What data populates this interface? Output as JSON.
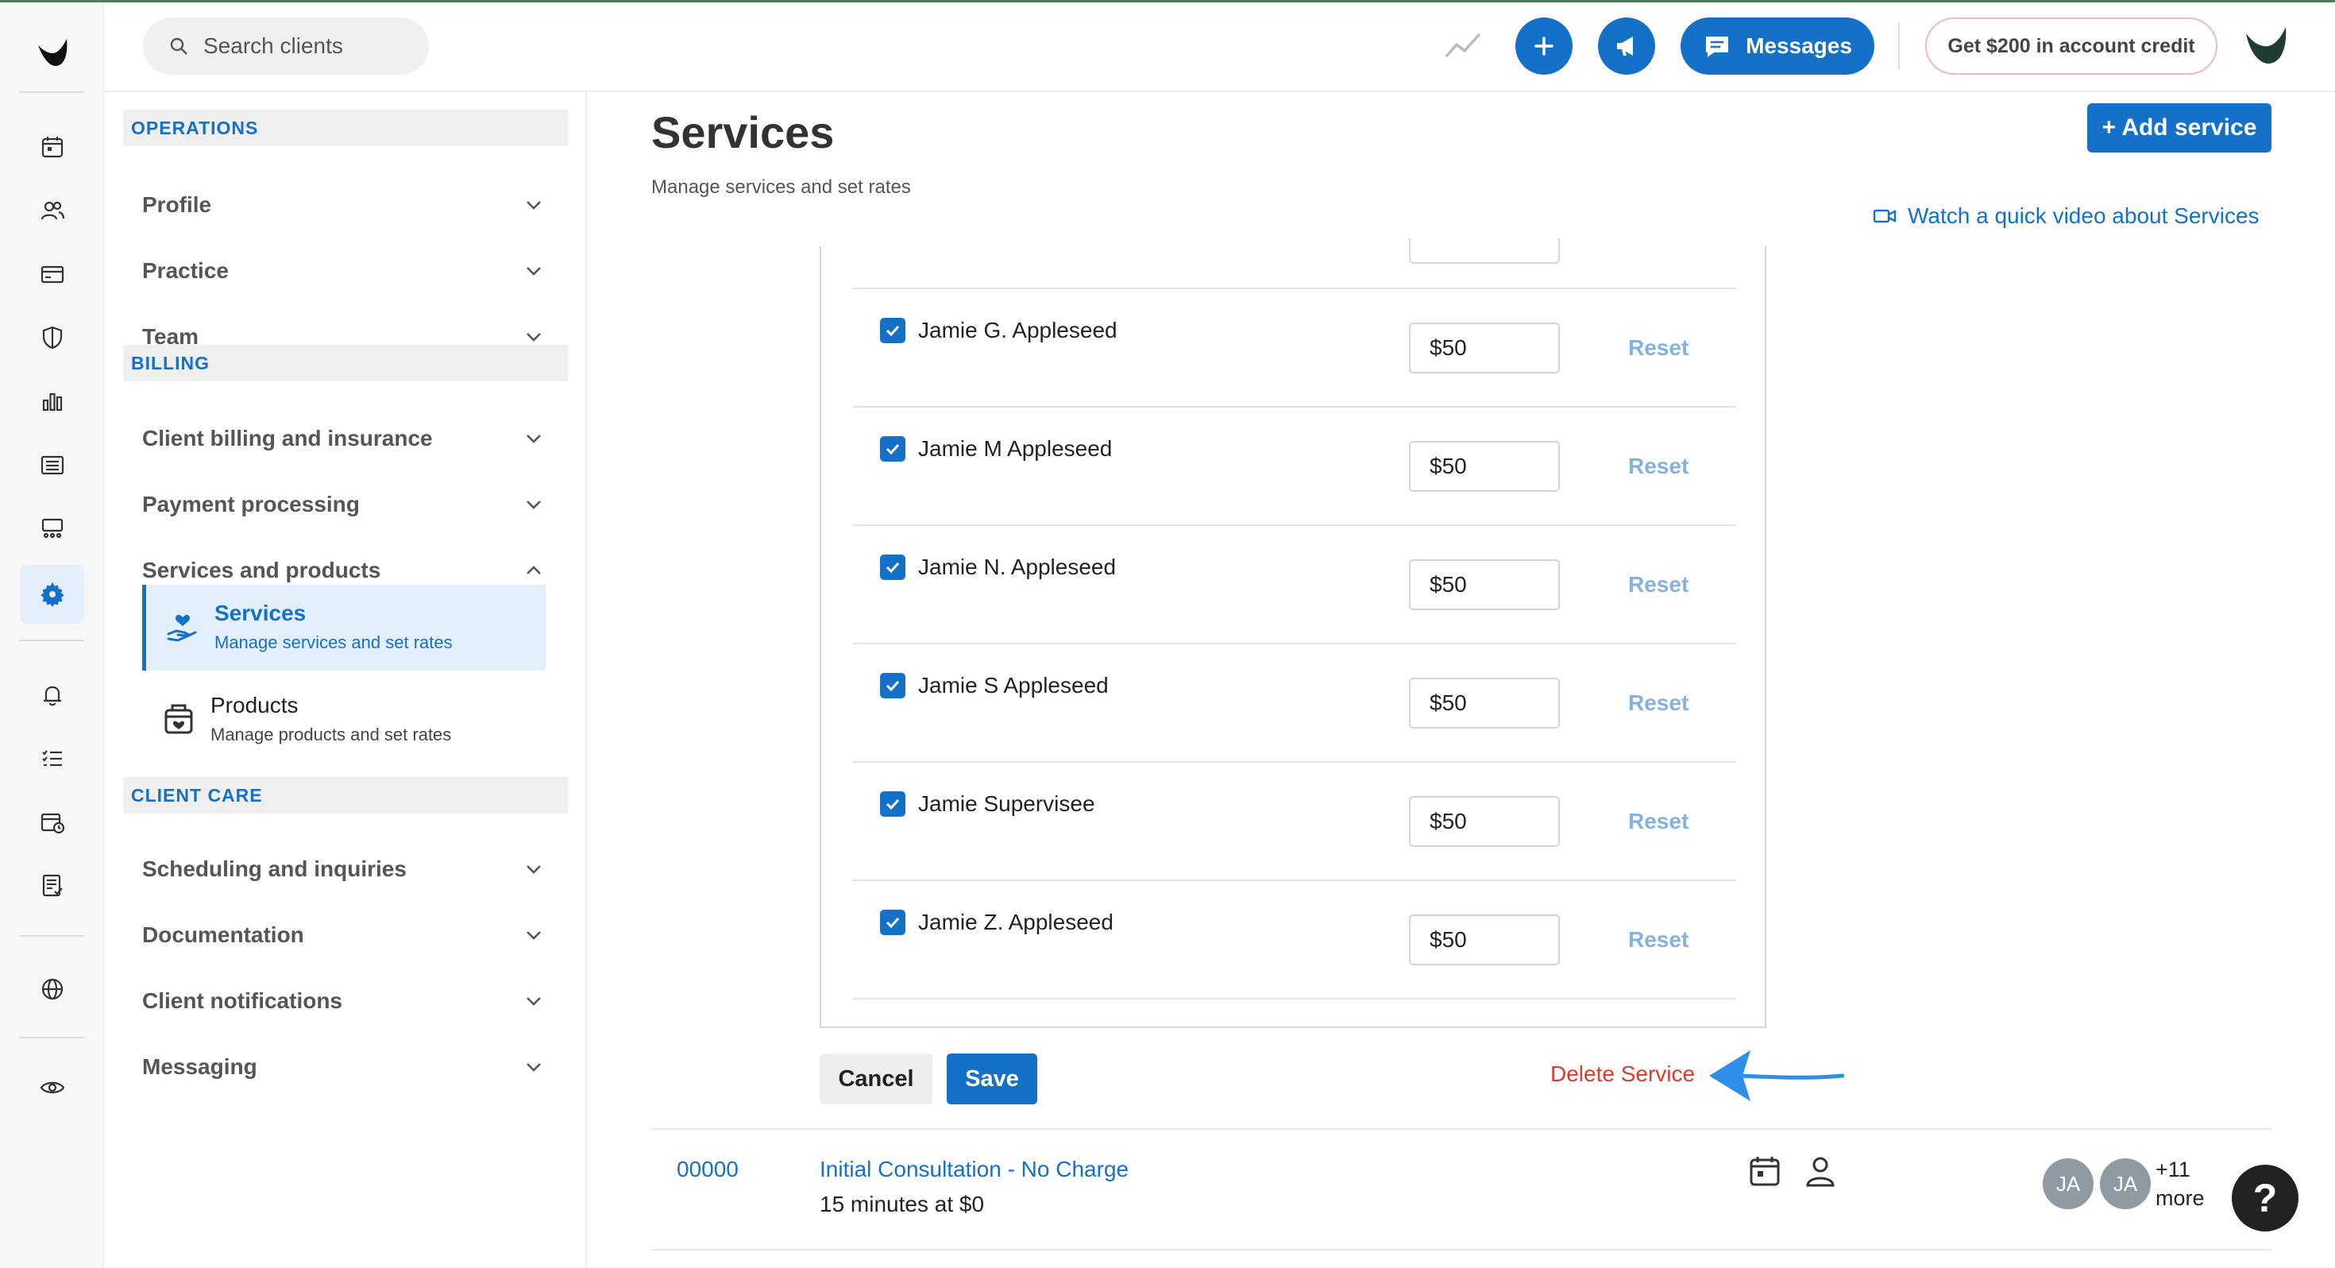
{
  "header": {
    "search_placeholder": "Search clients",
    "messages_label": "Messages",
    "credit_label": "Get $200 in account credit"
  },
  "rail": {
    "icons": [
      "calendar-icon",
      "clients-icon",
      "billing-card-icon",
      "insurance-shield-icon",
      "analytics-icon",
      "list-icon",
      "marketing-icon",
      "settings-gear-icon",
      "notifications-bell-icon",
      "tasks-icon",
      "schedule-icon",
      "documents-icon",
      "globe-icon",
      "eye-icon"
    ],
    "active": "settings-gear-icon"
  },
  "settings_nav": {
    "sections": [
      {
        "label": "OPERATIONS",
        "items": [
          "Profile",
          "Practice",
          "Team"
        ]
      },
      {
        "label": "BILLING",
        "items": [
          "Client billing and insurance",
          "Payment processing",
          "Services and products"
        ]
      },
      {
        "label": "CLIENT CARE",
        "items": [
          "Scheduling and inquiries",
          "Documentation",
          "Client notifications",
          "Messaging"
        ]
      }
    ],
    "sub_items": [
      {
        "title": "Services",
        "desc": "Manage services and set rates",
        "active": true
      },
      {
        "title": "Products",
        "desc": "Manage products and set rates",
        "active": false
      }
    ]
  },
  "main": {
    "title": "Services",
    "subtitle": "Manage services and set rates",
    "add_button": "+ Add service",
    "video_link": "Watch a quick video about Services",
    "clinicians": [
      {
        "name": "Jamie G. Appleseed",
        "rate": "$50",
        "checked": true
      },
      {
        "name": "Jamie M Appleseed",
        "rate": "$50",
        "checked": true
      },
      {
        "name": "Jamie N. Appleseed",
        "rate": "$50",
        "checked": true
      },
      {
        "name": "Jamie S Appleseed",
        "rate": "$50",
        "checked": true
      },
      {
        "name": "Jamie Supervisee",
        "rate": "$50",
        "checked": true
      },
      {
        "name": "Jamie Z. Appleseed",
        "rate": "$50",
        "checked": true
      }
    ],
    "reset_label": "Reset",
    "cancel_label": "Cancel",
    "save_label": "Save",
    "delete_label": "Delete Service",
    "service_row": {
      "code": "00000",
      "name": "Initial Consultation - No Charge",
      "duration": "15 minutes at $0",
      "chips": [
        "JA",
        "JA"
      ],
      "more_count": "+11",
      "more_label": "more"
    }
  },
  "help_label": "?",
  "colors": {
    "accent": "#1570c8",
    "danger": "#e03a2e",
    "arrow": "#2f8ee8"
  }
}
